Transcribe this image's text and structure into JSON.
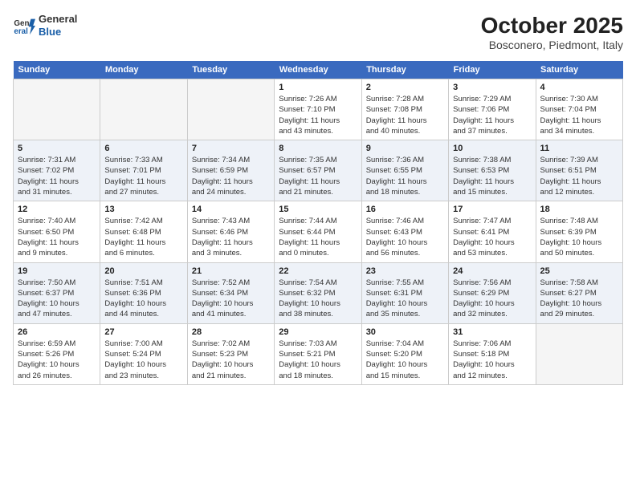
{
  "header": {
    "logo": {
      "general": "General",
      "blue": "Blue"
    },
    "title": "October 2025",
    "subtitle": "Bosconero, Piedmont, Italy"
  },
  "days": [
    "Sunday",
    "Monday",
    "Tuesday",
    "Wednesday",
    "Thursday",
    "Friday",
    "Saturday"
  ],
  "weeks": [
    [
      {
        "day": "",
        "info": ""
      },
      {
        "day": "",
        "info": ""
      },
      {
        "day": "",
        "info": ""
      },
      {
        "day": "1",
        "info": "Sunrise: 7:26 AM\nSunset: 7:10 PM\nDaylight: 11 hours\nand 43 minutes."
      },
      {
        "day": "2",
        "info": "Sunrise: 7:28 AM\nSunset: 7:08 PM\nDaylight: 11 hours\nand 40 minutes."
      },
      {
        "day": "3",
        "info": "Sunrise: 7:29 AM\nSunset: 7:06 PM\nDaylight: 11 hours\nand 37 minutes."
      },
      {
        "day": "4",
        "info": "Sunrise: 7:30 AM\nSunset: 7:04 PM\nDaylight: 11 hours\nand 34 minutes."
      }
    ],
    [
      {
        "day": "5",
        "info": "Sunrise: 7:31 AM\nSunset: 7:02 PM\nDaylight: 11 hours\nand 31 minutes."
      },
      {
        "day": "6",
        "info": "Sunrise: 7:33 AM\nSunset: 7:01 PM\nDaylight: 11 hours\nand 27 minutes."
      },
      {
        "day": "7",
        "info": "Sunrise: 7:34 AM\nSunset: 6:59 PM\nDaylight: 11 hours\nand 24 minutes."
      },
      {
        "day": "8",
        "info": "Sunrise: 7:35 AM\nSunset: 6:57 PM\nDaylight: 11 hours\nand 21 minutes."
      },
      {
        "day": "9",
        "info": "Sunrise: 7:36 AM\nSunset: 6:55 PM\nDaylight: 11 hours\nand 18 minutes."
      },
      {
        "day": "10",
        "info": "Sunrise: 7:38 AM\nSunset: 6:53 PM\nDaylight: 11 hours\nand 15 minutes."
      },
      {
        "day": "11",
        "info": "Sunrise: 7:39 AM\nSunset: 6:51 PM\nDaylight: 11 hours\nand 12 minutes."
      }
    ],
    [
      {
        "day": "12",
        "info": "Sunrise: 7:40 AM\nSunset: 6:50 PM\nDaylight: 11 hours\nand 9 minutes."
      },
      {
        "day": "13",
        "info": "Sunrise: 7:42 AM\nSunset: 6:48 PM\nDaylight: 11 hours\nand 6 minutes."
      },
      {
        "day": "14",
        "info": "Sunrise: 7:43 AM\nSunset: 6:46 PM\nDaylight: 11 hours\nand 3 minutes."
      },
      {
        "day": "15",
        "info": "Sunrise: 7:44 AM\nSunset: 6:44 PM\nDaylight: 11 hours\nand 0 minutes."
      },
      {
        "day": "16",
        "info": "Sunrise: 7:46 AM\nSunset: 6:43 PM\nDaylight: 10 hours\nand 56 minutes."
      },
      {
        "day": "17",
        "info": "Sunrise: 7:47 AM\nSunset: 6:41 PM\nDaylight: 10 hours\nand 53 minutes."
      },
      {
        "day": "18",
        "info": "Sunrise: 7:48 AM\nSunset: 6:39 PM\nDaylight: 10 hours\nand 50 minutes."
      }
    ],
    [
      {
        "day": "19",
        "info": "Sunrise: 7:50 AM\nSunset: 6:37 PM\nDaylight: 10 hours\nand 47 minutes."
      },
      {
        "day": "20",
        "info": "Sunrise: 7:51 AM\nSunset: 6:36 PM\nDaylight: 10 hours\nand 44 minutes."
      },
      {
        "day": "21",
        "info": "Sunrise: 7:52 AM\nSunset: 6:34 PM\nDaylight: 10 hours\nand 41 minutes."
      },
      {
        "day": "22",
        "info": "Sunrise: 7:54 AM\nSunset: 6:32 PM\nDaylight: 10 hours\nand 38 minutes."
      },
      {
        "day": "23",
        "info": "Sunrise: 7:55 AM\nSunset: 6:31 PM\nDaylight: 10 hours\nand 35 minutes."
      },
      {
        "day": "24",
        "info": "Sunrise: 7:56 AM\nSunset: 6:29 PM\nDaylight: 10 hours\nand 32 minutes."
      },
      {
        "day": "25",
        "info": "Sunrise: 7:58 AM\nSunset: 6:27 PM\nDaylight: 10 hours\nand 29 minutes."
      }
    ],
    [
      {
        "day": "26",
        "info": "Sunrise: 6:59 AM\nSunset: 5:26 PM\nDaylight: 10 hours\nand 26 minutes."
      },
      {
        "day": "27",
        "info": "Sunrise: 7:00 AM\nSunset: 5:24 PM\nDaylight: 10 hours\nand 23 minutes."
      },
      {
        "day": "28",
        "info": "Sunrise: 7:02 AM\nSunset: 5:23 PM\nDaylight: 10 hours\nand 21 minutes."
      },
      {
        "day": "29",
        "info": "Sunrise: 7:03 AM\nSunset: 5:21 PM\nDaylight: 10 hours\nand 18 minutes."
      },
      {
        "day": "30",
        "info": "Sunrise: 7:04 AM\nSunset: 5:20 PM\nDaylight: 10 hours\nand 15 minutes."
      },
      {
        "day": "31",
        "info": "Sunrise: 7:06 AM\nSunset: 5:18 PM\nDaylight: 10 hours\nand 12 minutes."
      },
      {
        "day": "",
        "info": ""
      }
    ]
  ]
}
